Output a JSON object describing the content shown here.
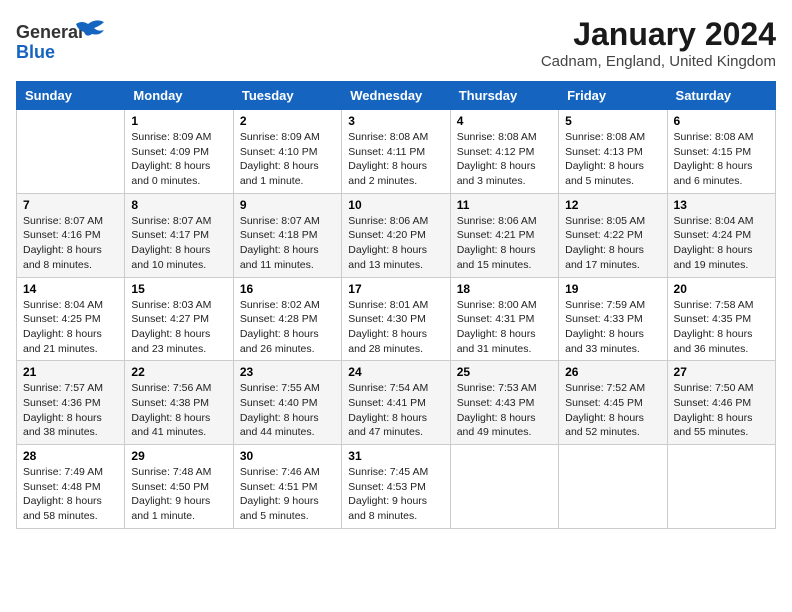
{
  "logo": {
    "general": "General",
    "blue": "Blue"
  },
  "header": {
    "month": "January 2024",
    "location": "Cadnam, England, United Kingdom"
  },
  "weekdays": [
    "Sunday",
    "Monday",
    "Tuesday",
    "Wednesday",
    "Thursday",
    "Friday",
    "Saturday"
  ],
  "weeks": [
    [
      {
        "day": "",
        "sunrise": "",
        "sunset": "",
        "daylight": ""
      },
      {
        "day": "1",
        "sunrise": "Sunrise: 8:09 AM",
        "sunset": "Sunset: 4:09 PM",
        "daylight": "Daylight: 8 hours and 0 minutes."
      },
      {
        "day": "2",
        "sunrise": "Sunrise: 8:09 AM",
        "sunset": "Sunset: 4:10 PM",
        "daylight": "Daylight: 8 hours and 1 minute."
      },
      {
        "day": "3",
        "sunrise": "Sunrise: 8:08 AM",
        "sunset": "Sunset: 4:11 PM",
        "daylight": "Daylight: 8 hours and 2 minutes."
      },
      {
        "day": "4",
        "sunrise": "Sunrise: 8:08 AM",
        "sunset": "Sunset: 4:12 PM",
        "daylight": "Daylight: 8 hours and 3 minutes."
      },
      {
        "day": "5",
        "sunrise": "Sunrise: 8:08 AM",
        "sunset": "Sunset: 4:13 PM",
        "daylight": "Daylight: 8 hours and 5 minutes."
      },
      {
        "day": "6",
        "sunrise": "Sunrise: 8:08 AM",
        "sunset": "Sunset: 4:15 PM",
        "daylight": "Daylight: 8 hours and 6 minutes."
      }
    ],
    [
      {
        "day": "7",
        "sunrise": "Sunrise: 8:07 AM",
        "sunset": "Sunset: 4:16 PM",
        "daylight": "Daylight: 8 hours and 8 minutes."
      },
      {
        "day": "8",
        "sunrise": "Sunrise: 8:07 AM",
        "sunset": "Sunset: 4:17 PM",
        "daylight": "Daylight: 8 hours and 10 minutes."
      },
      {
        "day": "9",
        "sunrise": "Sunrise: 8:07 AM",
        "sunset": "Sunset: 4:18 PM",
        "daylight": "Daylight: 8 hours and 11 minutes."
      },
      {
        "day": "10",
        "sunrise": "Sunrise: 8:06 AM",
        "sunset": "Sunset: 4:20 PM",
        "daylight": "Daylight: 8 hours and 13 minutes."
      },
      {
        "day": "11",
        "sunrise": "Sunrise: 8:06 AM",
        "sunset": "Sunset: 4:21 PM",
        "daylight": "Daylight: 8 hours and 15 minutes."
      },
      {
        "day": "12",
        "sunrise": "Sunrise: 8:05 AM",
        "sunset": "Sunset: 4:22 PM",
        "daylight": "Daylight: 8 hours and 17 minutes."
      },
      {
        "day": "13",
        "sunrise": "Sunrise: 8:04 AM",
        "sunset": "Sunset: 4:24 PM",
        "daylight": "Daylight: 8 hours and 19 minutes."
      }
    ],
    [
      {
        "day": "14",
        "sunrise": "Sunrise: 8:04 AM",
        "sunset": "Sunset: 4:25 PM",
        "daylight": "Daylight: 8 hours and 21 minutes."
      },
      {
        "day": "15",
        "sunrise": "Sunrise: 8:03 AM",
        "sunset": "Sunset: 4:27 PM",
        "daylight": "Daylight: 8 hours and 23 minutes."
      },
      {
        "day": "16",
        "sunrise": "Sunrise: 8:02 AM",
        "sunset": "Sunset: 4:28 PM",
        "daylight": "Daylight: 8 hours and 26 minutes."
      },
      {
        "day": "17",
        "sunrise": "Sunrise: 8:01 AM",
        "sunset": "Sunset: 4:30 PM",
        "daylight": "Daylight: 8 hours and 28 minutes."
      },
      {
        "day": "18",
        "sunrise": "Sunrise: 8:00 AM",
        "sunset": "Sunset: 4:31 PM",
        "daylight": "Daylight: 8 hours and 31 minutes."
      },
      {
        "day": "19",
        "sunrise": "Sunrise: 7:59 AM",
        "sunset": "Sunset: 4:33 PM",
        "daylight": "Daylight: 8 hours and 33 minutes."
      },
      {
        "day": "20",
        "sunrise": "Sunrise: 7:58 AM",
        "sunset": "Sunset: 4:35 PM",
        "daylight": "Daylight: 8 hours and 36 minutes."
      }
    ],
    [
      {
        "day": "21",
        "sunrise": "Sunrise: 7:57 AM",
        "sunset": "Sunset: 4:36 PM",
        "daylight": "Daylight: 8 hours and 38 minutes."
      },
      {
        "day": "22",
        "sunrise": "Sunrise: 7:56 AM",
        "sunset": "Sunset: 4:38 PM",
        "daylight": "Daylight: 8 hours and 41 minutes."
      },
      {
        "day": "23",
        "sunrise": "Sunrise: 7:55 AM",
        "sunset": "Sunset: 4:40 PM",
        "daylight": "Daylight: 8 hours and 44 minutes."
      },
      {
        "day": "24",
        "sunrise": "Sunrise: 7:54 AM",
        "sunset": "Sunset: 4:41 PM",
        "daylight": "Daylight: 8 hours and 47 minutes."
      },
      {
        "day": "25",
        "sunrise": "Sunrise: 7:53 AM",
        "sunset": "Sunset: 4:43 PM",
        "daylight": "Daylight: 8 hours and 49 minutes."
      },
      {
        "day": "26",
        "sunrise": "Sunrise: 7:52 AM",
        "sunset": "Sunset: 4:45 PM",
        "daylight": "Daylight: 8 hours and 52 minutes."
      },
      {
        "day": "27",
        "sunrise": "Sunrise: 7:50 AM",
        "sunset": "Sunset: 4:46 PM",
        "daylight": "Daylight: 8 hours and 55 minutes."
      }
    ],
    [
      {
        "day": "28",
        "sunrise": "Sunrise: 7:49 AM",
        "sunset": "Sunset: 4:48 PM",
        "daylight": "Daylight: 8 hours and 58 minutes."
      },
      {
        "day": "29",
        "sunrise": "Sunrise: 7:48 AM",
        "sunset": "Sunset: 4:50 PM",
        "daylight": "Daylight: 9 hours and 1 minute."
      },
      {
        "day": "30",
        "sunrise": "Sunrise: 7:46 AM",
        "sunset": "Sunset: 4:51 PM",
        "daylight": "Daylight: 9 hours and 5 minutes."
      },
      {
        "day": "31",
        "sunrise": "Sunrise: 7:45 AM",
        "sunset": "Sunset: 4:53 PM",
        "daylight": "Daylight: 9 hours and 8 minutes."
      },
      {
        "day": "",
        "sunrise": "",
        "sunset": "",
        "daylight": ""
      },
      {
        "day": "",
        "sunrise": "",
        "sunset": "",
        "daylight": ""
      },
      {
        "day": "",
        "sunrise": "",
        "sunset": "",
        "daylight": ""
      }
    ]
  ]
}
